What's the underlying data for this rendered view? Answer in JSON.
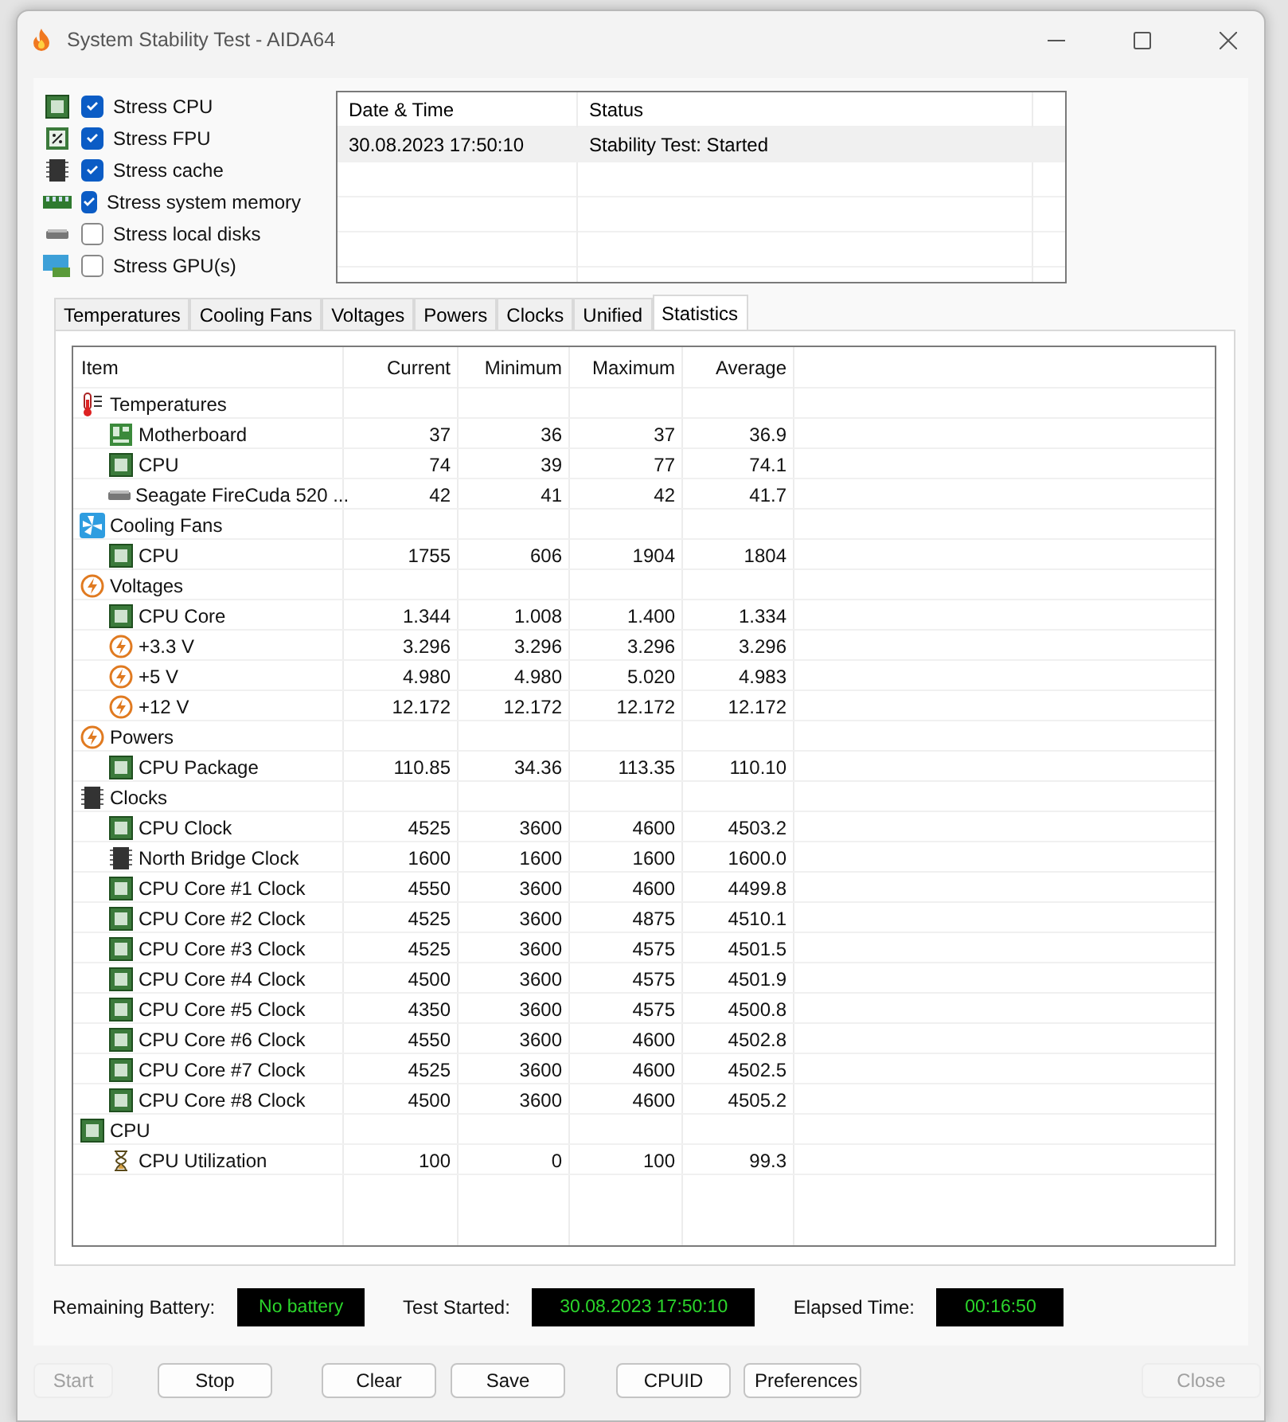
{
  "window": {
    "title": "System Stability Test - AIDA64"
  },
  "stress_options": [
    {
      "label": "Stress CPU",
      "checked": true
    },
    {
      "label": "Stress FPU",
      "checked": true
    },
    {
      "label": "Stress cache",
      "checked": true
    },
    {
      "label": "Stress system memory",
      "checked": true
    },
    {
      "label": "Stress local disks",
      "checked": false
    },
    {
      "label": "Stress GPU(s)",
      "checked": false
    }
  ],
  "log": {
    "columns": [
      "Date & Time",
      "Status"
    ],
    "rows": [
      {
        "cells": [
          "30.08.2023 17:50:10",
          "Stability Test: Started"
        ],
        "selected": true
      }
    ]
  },
  "tabs": [
    {
      "label": "Temperatures",
      "selected": false
    },
    {
      "label": "Cooling Fans",
      "selected": false
    },
    {
      "label": "Voltages",
      "selected": false
    },
    {
      "label": "Powers",
      "selected": false
    },
    {
      "label": "Clocks",
      "selected": false
    },
    {
      "label": "Unified",
      "selected": false
    },
    {
      "label": "Statistics",
      "selected": true
    }
  ],
  "table": {
    "columns": [
      "Item",
      "Current",
      "Minimum",
      "Maximum",
      "Average"
    ],
    "groups": [
      {
        "label": "Temperatures",
        "kind": "temperature",
        "children": [
          {
            "label": "Motherboard",
            "kind": "board",
            "values": [
              "37",
              "36",
              "37",
              "36.9"
            ]
          },
          {
            "label": "CPU",
            "kind": "chip",
            "values": [
              "74",
              "39",
              "77",
              "74.1"
            ]
          },
          {
            "label": "Seagate FireCuda 520 ...",
            "kind": "disk",
            "values": [
              "42",
              "41",
              "42",
              "41.7"
            ]
          }
        ]
      },
      {
        "label": "Cooling Fans",
        "kind": "fan",
        "children": [
          {
            "label": "CPU",
            "kind": "chip",
            "values": [
              "1755",
              "606",
              "1904",
              "1804"
            ]
          }
        ]
      },
      {
        "label": "Voltages",
        "kind": "voltage",
        "children": [
          {
            "label": "CPU Core",
            "kind": "chip",
            "values": [
              "1.344",
              "1.008",
              "1.400",
              "1.334"
            ]
          },
          {
            "label": "+3.3 V",
            "kind": "voltage",
            "values": [
              "3.296",
              "3.296",
              "3.296",
              "3.296"
            ]
          },
          {
            "label": "+5 V",
            "kind": "voltage",
            "values": [
              "4.980",
              "4.980",
              "5.020",
              "4.983"
            ]
          },
          {
            "label": "+12 V",
            "kind": "voltage",
            "values": [
              "12.172",
              "12.172",
              "12.172",
              "12.172"
            ]
          }
        ]
      },
      {
        "label": "Powers",
        "kind": "voltage",
        "children": [
          {
            "label": "CPU Package",
            "kind": "chip",
            "values": [
              "110.85",
              "34.36",
              "113.35",
              "110.10"
            ]
          }
        ]
      },
      {
        "label": "Clocks",
        "kind": "memory",
        "children": [
          {
            "label": "CPU Clock",
            "kind": "chip",
            "values": [
              "4525",
              "3600",
              "4600",
              "4503.2"
            ]
          },
          {
            "label": "North Bridge Clock",
            "kind": "memory",
            "values": [
              "1600",
              "1600",
              "1600",
              "1600.0"
            ]
          },
          {
            "label": "CPU Core #1 Clock",
            "kind": "chip",
            "values": [
              "4550",
              "3600",
              "4600",
              "4499.8"
            ]
          },
          {
            "label": "CPU Core #2 Clock",
            "kind": "chip",
            "values": [
              "4525",
              "3600",
              "4875",
              "4510.1"
            ]
          },
          {
            "label": "CPU Core #3 Clock",
            "kind": "chip",
            "values": [
              "4525",
              "3600",
              "4575",
              "4501.5"
            ]
          },
          {
            "label": "CPU Core #4 Clock",
            "kind": "chip",
            "values": [
              "4500",
              "3600",
              "4575",
              "4501.9"
            ]
          },
          {
            "label": "CPU Core #5 Clock",
            "kind": "chip",
            "values": [
              "4350",
              "3600",
              "4575",
              "4500.8"
            ]
          },
          {
            "label": "CPU Core #6 Clock",
            "kind": "chip",
            "values": [
              "4550",
              "3600",
              "4600",
              "4502.8"
            ]
          },
          {
            "label": "CPU Core #7 Clock",
            "kind": "chip",
            "values": [
              "4525",
              "3600",
              "4600",
              "4502.5"
            ]
          },
          {
            "label": "CPU Core #8 Clock",
            "kind": "chip",
            "values": [
              "4500",
              "3600",
              "4600",
              "4505.2"
            ]
          }
        ]
      },
      {
        "label": "CPU",
        "kind": "chip",
        "children": [
          {
            "label": "CPU Utilization",
            "kind": "hourglass",
            "values": [
              "100",
              "0",
              "100",
              "99.3"
            ]
          }
        ]
      }
    ]
  },
  "status": [
    {
      "label": "Remaining Battery:",
      "value": "No battery"
    },
    {
      "label": "Test Started:",
      "value": "30.08.2023 17:50:10"
    },
    {
      "label": "Elapsed Time:",
      "value": "00:16:50"
    }
  ],
  "buttons": [
    {
      "label": "Start",
      "disabled": true
    },
    {
      "label": "Stop",
      "disabled": false
    },
    {
      "label": "Clear",
      "disabled": false
    },
    {
      "label": "Save",
      "disabled": false
    },
    {
      "label": "CPUID",
      "disabled": false
    },
    {
      "label": "Preferences",
      "disabled": false
    },
    {
      "label": "Close",
      "disabled": true
    }
  ]
}
